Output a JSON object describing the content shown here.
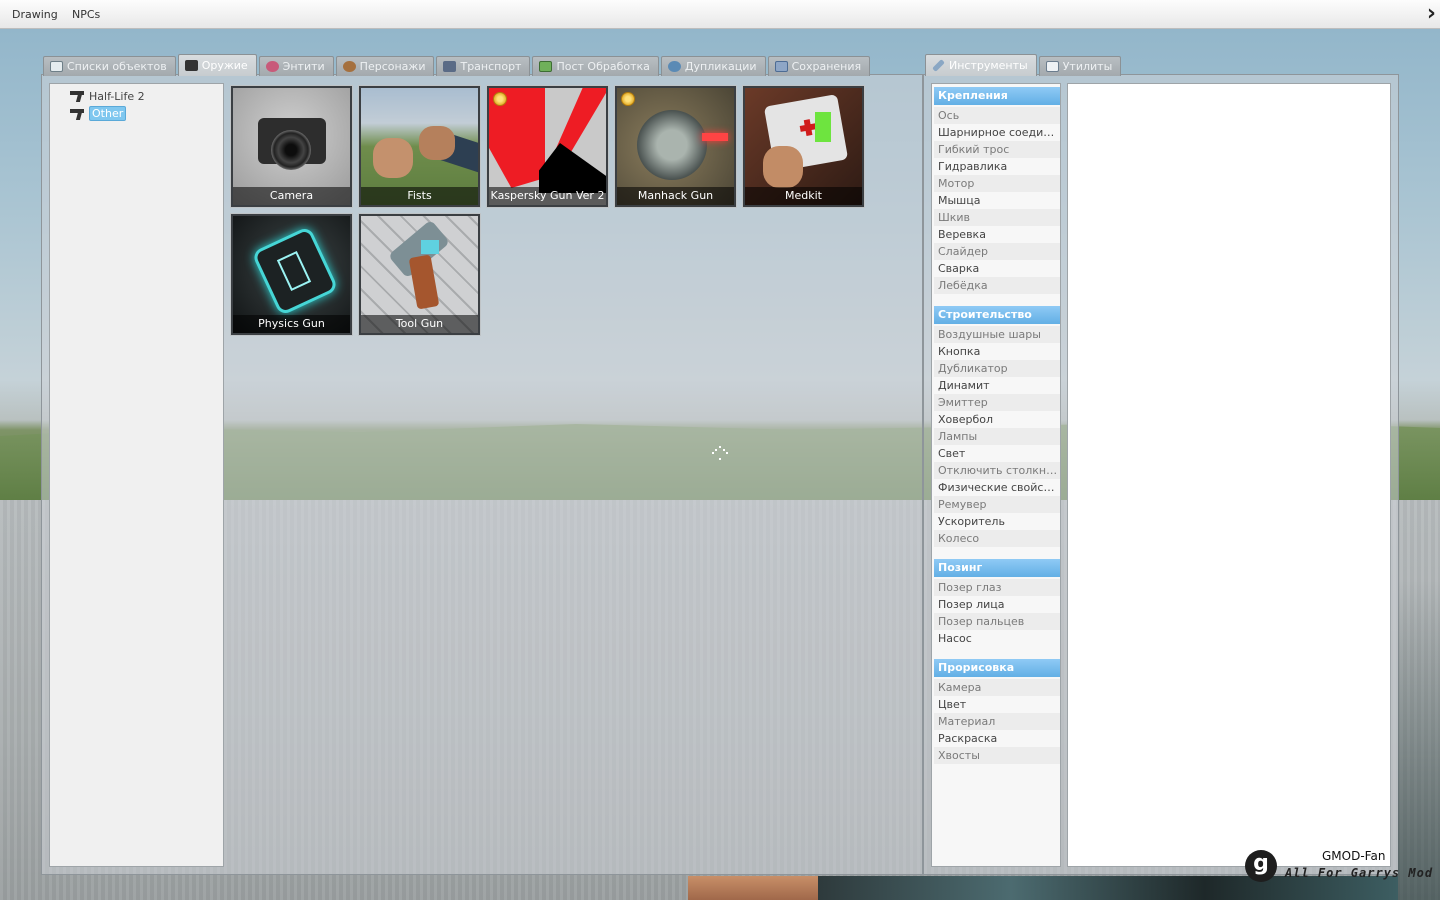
{
  "menubar": {
    "items": [
      "Drawing",
      "NPCs"
    ]
  },
  "spawn_tabs": [
    {
      "label": "Списки объектов",
      "icon": "grid-icon",
      "active": false
    },
    {
      "label": "Оружие",
      "icon": "pistol-icon",
      "active": true
    },
    {
      "label": "Энтити",
      "icon": "entity-icon",
      "active": false
    },
    {
      "label": "Персонажи",
      "icon": "monkey-icon",
      "active": false
    },
    {
      "label": "Транспорт",
      "icon": "car-icon",
      "active": false
    },
    {
      "label": "Пост Обработка",
      "icon": "image-icon",
      "active": false
    },
    {
      "label": "Дупликации",
      "icon": "copy-icon",
      "active": false
    },
    {
      "label": "Сохранения",
      "icon": "save-icon",
      "active": false
    }
  ],
  "tree": {
    "items": [
      {
        "label": "Half-Life 2",
        "selected": false
      },
      {
        "label": "Other",
        "selected": true
      }
    ]
  },
  "weapons": [
    {
      "name": "Camera",
      "badge": false
    },
    {
      "name": "Fists",
      "badge": false
    },
    {
      "name": "Kaspersky Gun Ver 2",
      "badge": true
    },
    {
      "name": "Manhack Gun",
      "badge": true
    },
    {
      "name": "Medkit",
      "badge": false
    },
    {
      "name": "Physics Gun",
      "badge": false
    },
    {
      "name": "Tool Gun",
      "badge": false
    }
  ],
  "tools_tabs": [
    {
      "label": "Инструменты",
      "icon": "wrench-icon",
      "active": true
    },
    {
      "label": "Утилиты",
      "icon": "page-icon",
      "active": false
    }
  ],
  "tool_categories": [
    {
      "title": "Крепления",
      "items": [
        "Ось",
        "Шарнирное соединение",
        "Гибкий трос",
        "Гидравлика",
        "Мотор",
        "Мышца",
        "Шкив",
        "Веревка",
        "Слайдер",
        "Сварка",
        "Лебёдка"
      ]
    },
    {
      "title": "Строительство",
      "items": [
        "Воздушные шары",
        "Кнопка",
        "Дубликатор",
        "Динамит",
        "Эмиттер",
        "Ховербол",
        "Лампы",
        "Свет",
        "Отключить столкновения",
        "Физические свойства",
        "Ремувер",
        "Ускоритель",
        "Колесо"
      ]
    },
    {
      "title": "Позинг",
      "items": [
        "Позер глаз",
        "Позер лица",
        "Позер пальцев",
        "Насос"
      ]
    },
    {
      "title": "Прорисовка",
      "items": [
        "Камера",
        "Цвет",
        "Материал",
        "Раскраска",
        "Хвосты"
      ]
    }
  ],
  "watermark": {
    "logo": "g",
    "title": "GMOD-Fan",
    "subtitle": "All For Garrys Mod"
  }
}
